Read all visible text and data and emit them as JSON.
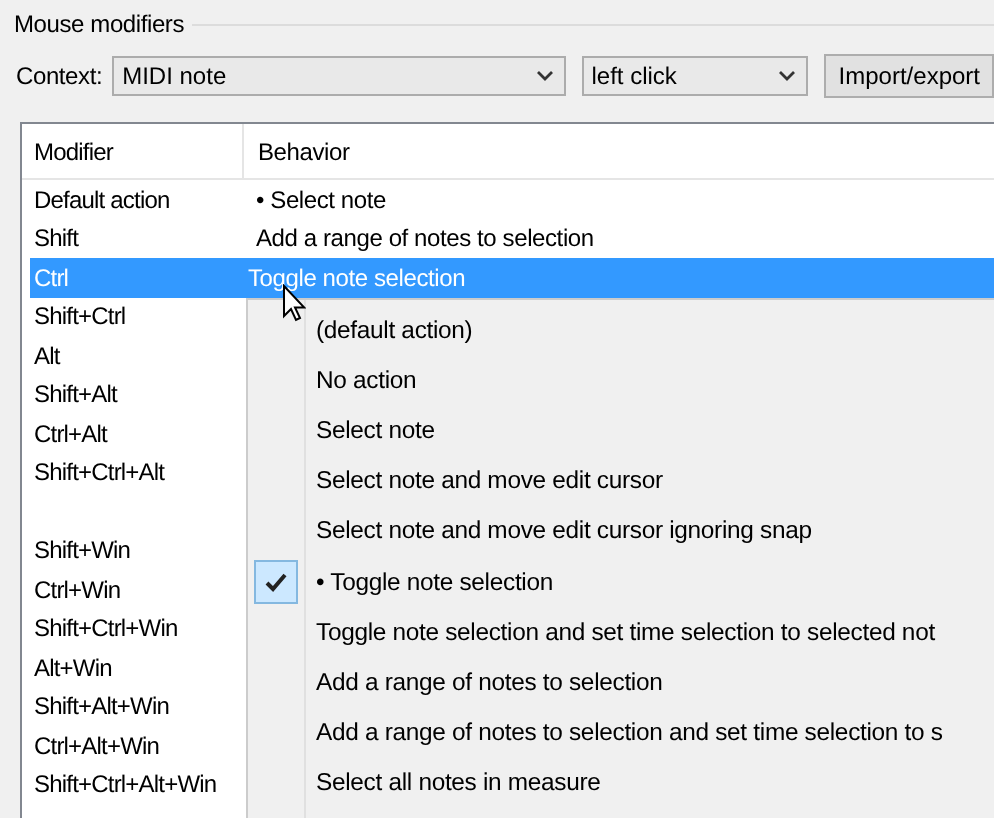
{
  "group": {
    "title": "Mouse modifiers"
  },
  "context": {
    "label": "Context:",
    "value": "MIDI note"
  },
  "action": {
    "value": "left click"
  },
  "import_button": {
    "label": "Import/export"
  },
  "table": {
    "columns": [
      "Modifier",
      "Behavior"
    ],
    "rows": [
      {
        "modifier": "Default action",
        "behavior": "• Select note",
        "selected": false,
        "gap_before": false
      },
      {
        "modifier": "Shift",
        "behavior": "Add a range of notes to selection",
        "selected": false,
        "gap_before": false
      },
      {
        "modifier": "Ctrl",
        "behavior": "Toggle note selection",
        "selected": true,
        "gap_before": false
      },
      {
        "modifier": "Shift+Ctrl",
        "selected": false,
        "gap_before": false
      },
      {
        "modifier": "Alt",
        "selected": false,
        "gap_before": false
      },
      {
        "modifier": "Shift+Alt",
        "selected": false,
        "gap_before": false
      },
      {
        "modifier": "Ctrl+Alt",
        "selected": false,
        "gap_before": false
      },
      {
        "modifier": "Shift+Ctrl+Alt",
        "selected": false,
        "gap_before": false
      },
      {
        "modifier": "Shift+Win",
        "selected": false,
        "gap_before": true
      },
      {
        "modifier": "Ctrl+Win",
        "selected": false,
        "gap_before": false
      },
      {
        "modifier": "Shift+Ctrl+Win",
        "selected": false,
        "gap_before": false
      },
      {
        "modifier": "Alt+Win",
        "selected": false,
        "gap_before": false
      },
      {
        "modifier": "Shift+Alt+Win",
        "selected": false,
        "gap_before": false
      },
      {
        "modifier": "Ctrl+Alt+Win",
        "selected": false,
        "gap_before": false
      },
      {
        "modifier": "Shift+Ctrl+Alt+Win",
        "selected": false,
        "gap_before": false
      }
    ]
  },
  "menu": {
    "items": [
      {
        "label": "(default action)",
        "checked": false
      },
      {
        "label": "No action",
        "checked": false
      },
      {
        "label": "Select note",
        "checked": false
      },
      {
        "label": "Select note and move edit cursor",
        "checked": false
      },
      {
        "label": "Select note and move edit cursor ignoring snap",
        "checked": false
      },
      {
        "label": "• Toggle note selection",
        "checked": true
      },
      {
        "label": "Toggle note selection and set time selection to selected not",
        "checked": false
      },
      {
        "label": "Add a range of notes to selection",
        "checked": false
      },
      {
        "label": "Add a range of notes to selection and set time selection to s",
        "checked": false
      },
      {
        "label": "Select all notes in measure",
        "checked": false
      }
    ]
  }
}
